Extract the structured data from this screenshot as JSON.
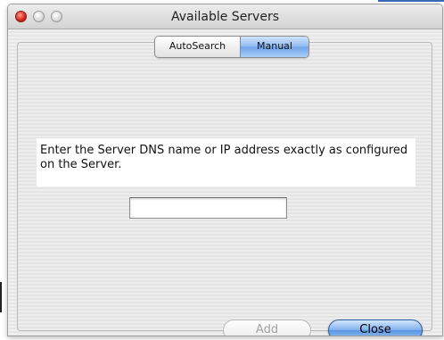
{
  "window": {
    "title": "Available Servers"
  },
  "tabs": [
    {
      "label": "AutoSearch",
      "selected": false
    },
    {
      "label": "Manual",
      "selected": true
    }
  ],
  "instructions": "Enter the Server DNS name or IP address exactly as configured on the Server.",
  "server_field": {
    "value": "",
    "placeholder": ""
  },
  "buttons": {
    "add_label": "Add",
    "add_enabled": false,
    "close_label": "Close",
    "close_default": true
  },
  "colors": {
    "close_traffic": "#d2261c",
    "selected_tab": "#8fbaf0",
    "default_button": "#5a94e0",
    "accent": "#3a6ab8"
  }
}
